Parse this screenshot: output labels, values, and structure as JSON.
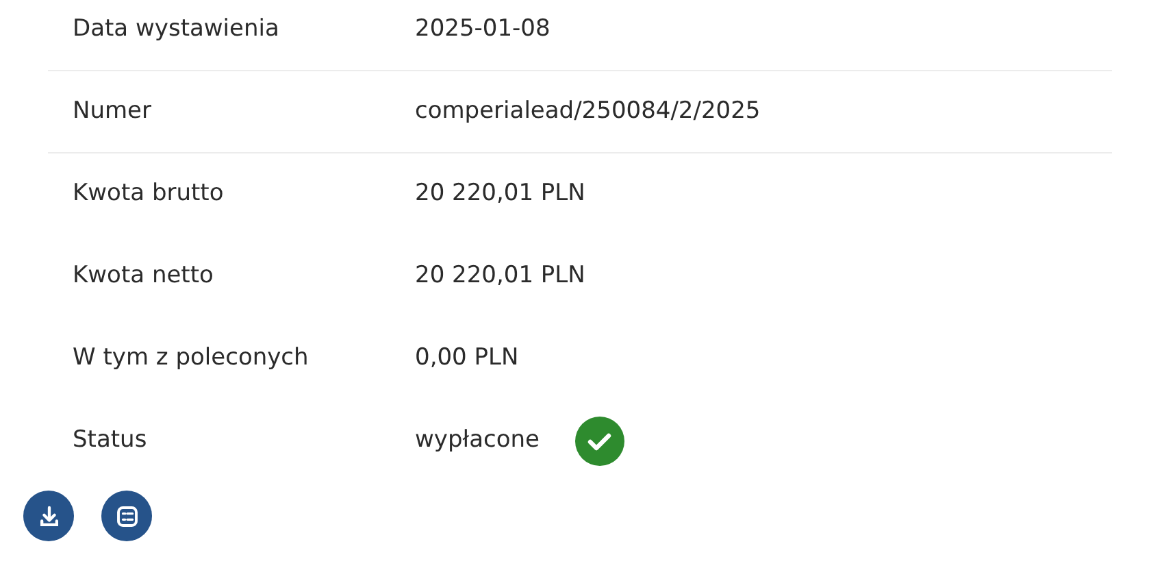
{
  "rows": [
    {
      "label": "Data wystawienia",
      "value": "2025-01-08",
      "divider": true
    },
    {
      "label": "Numer",
      "value": "comperialead/250084/2/2025",
      "divider": true
    },
    {
      "label": "Kwota brutto",
      "value": "20 220,01 PLN",
      "divider": false
    },
    {
      "label": "Kwota netto",
      "value": "20 220,01 PLN",
      "divider": false
    },
    {
      "label": "W tym z poleconych",
      "value": "0,00 PLN",
      "divider": false
    },
    {
      "label": "Status",
      "value": "wypłacone",
      "divider": false,
      "paid": true
    }
  ],
  "actions": [
    {
      "kind": "download"
    },
    {
      "kind": "details"
    }
  ]
}
